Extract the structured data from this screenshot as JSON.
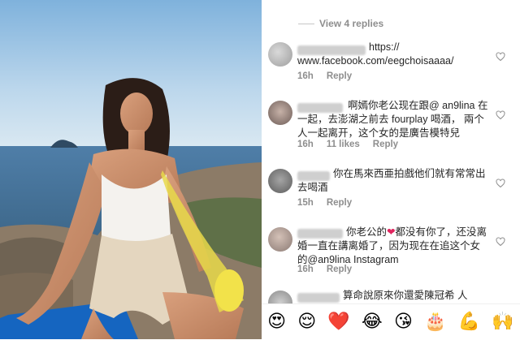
{
  "replies": {
    "view_label": "View 4 replies"
  },
  "comments": [
    {
      "text": "https://\nwww.facebook.com/eegchoisaaaa/",
      "time": "16h",
      "likes": "",
      "reply": "Reply"
    },
    {
      "text": "啊嫣你老公现在跟@ an9lina 在一起，去澎湖之前去 fourplay 喝酒， 兩个人一起离开，这个女的是廣告模特兒",
      "time": "16h",
      "likes": "11 likes",
      "reply": "Reply"
    },
    {
      "text": "你在馬來西亜拍戲他们就有常常出去喝酒",
      "time": "15h",
      "likes": "",
      "reply": "Reply"
    },
    {
      "text_a": "你老公的",
      "text_b": "都没有你了，还没离婚一直在講离婚了，因为现在在追这个女的@an9lina Instagram",
      "time": "16h",
      "likes": "",
      "reply": "Reply"
    },
    {
      "text": "算命說原來你還愛陳冠希 人"
    }
  ],
  "colors": {
    "heart": "#e0245e",
    "meta": "#8e8e8e",
    "text": "#262626"
  },
  "emoji_bar": {
    "items": [
      "😍",
      "😌",
      "❤️",
      "😂",
      "😘",
      "🎂",
      "💪",
      "🙌"
    ]
  },
  "icons": {
    "like": "heart-outline-icon"
  }
}
